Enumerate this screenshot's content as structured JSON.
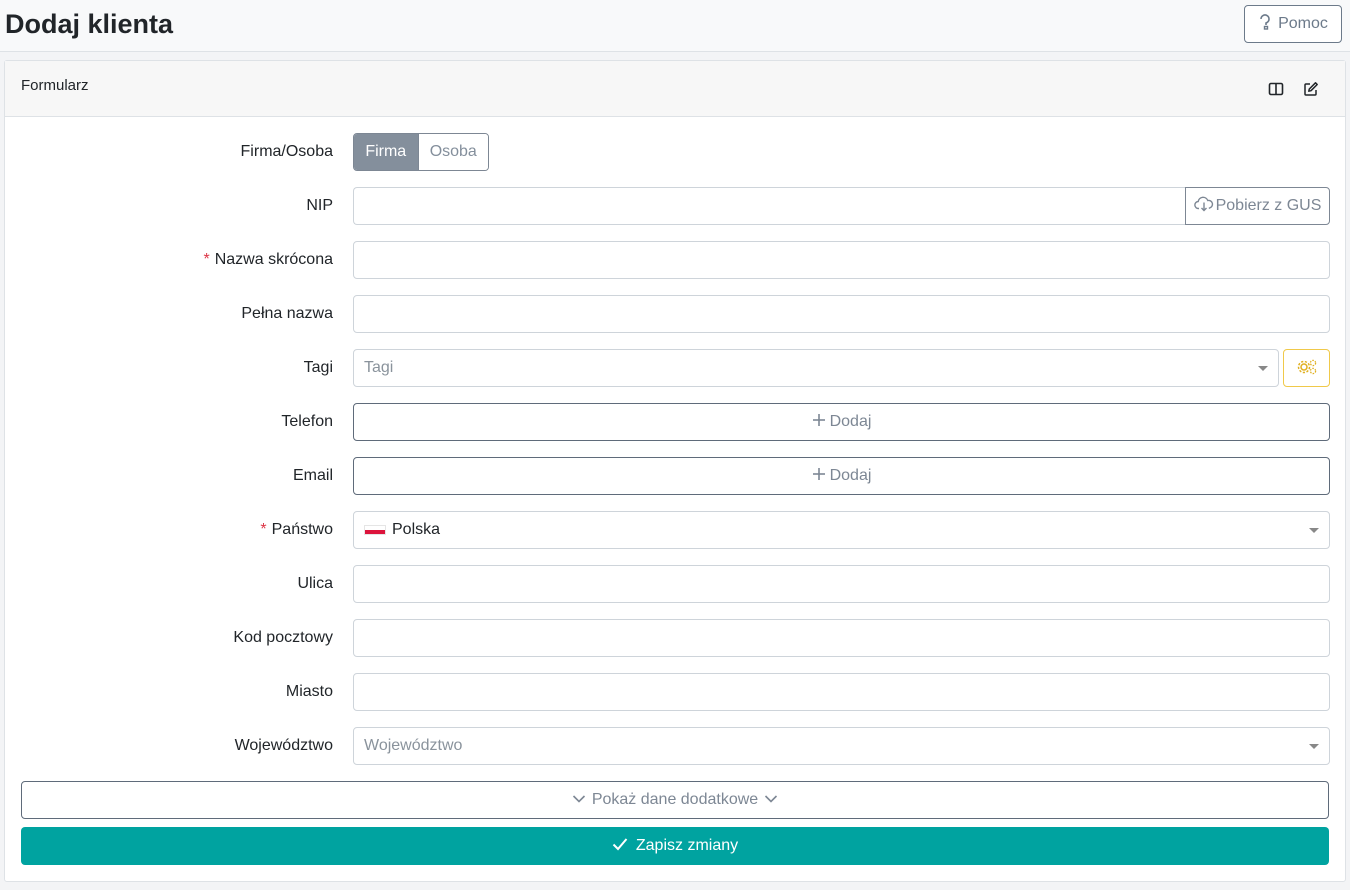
{
  "header": {
    "title": "Dodaj klienta",
    "help_label": "Pomoc"
  },
  "card": {
    "title": "Formularz"
  },
  "form": {
    "type": {
      "label": "Firma/Osoba",
      "options": [
        "Firma",
        "Osoba"
      ],
      "selected": "Firma"
    },
    "nip": {
      "label": "NIP",
      "value": "",
      "gus_button": "Pobierz z GUS"
    },
    "short_name": {
      "label": "Nazwa skrócona",
      "required_mark": "*",
      "value": ""
    },
    "full_name": {
      "label": "Pełna nazwa",
      "value": ""
    },
    "tags": {
      "label": "Tagi",
      "placeholder": "Tagi"
    },
    "phone": {
      "label": "Telefon",
      "add_label": "Dodaj"
    },
    "email": {
      "label": "Email",
      "add_label": "Dodaj"
    },
    "country": {
      "label": "Państwo",
      "required_mark": "*",
      "value": "Polska"
    },
    "street": {
      "label": "Ulica",
      "value": ""
    },
    "postal_code": {
      "label": "Kod pocztowy",
      "value": ""
    },
    "city": {
      "label": "Miasto",
      "value": ""
    },
    "province": {
      "label": "Województwo",
      "placeholder": "Województwo"
    }
  },
  "actions": {
    "more_label": "Pokaż dane dodatkowe",
    "save_label": "Zapisz zmiany"
  },
  "colors": {
    "accent": "#00a3a0",
    "required": "#dc3545",
    "tag_button_border": "#f0c94a"
  }
}
